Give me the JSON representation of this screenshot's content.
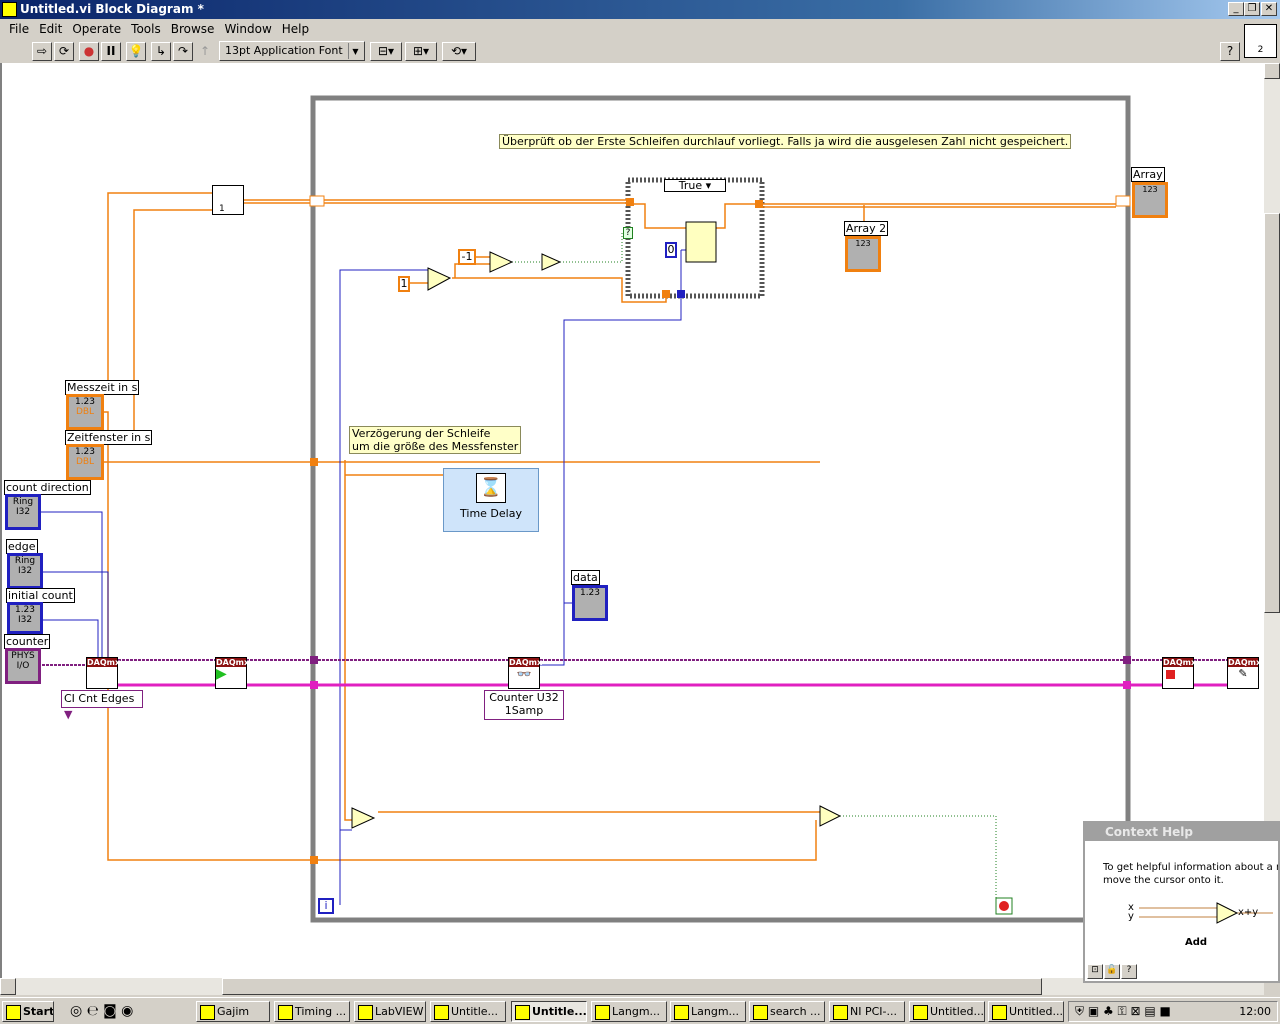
{
  "window": {
    "title": "Untitled.vi Block Diagram *"
  },
  "menu": [
    "File",
    "Edit",
    "Operate",
    "Tools",
    "Browse",
    "Window",
    "Help"
  ],
  "toolbar": {
    "font": "13pt Application Font",
    "instance": "2"
  },
  "diagram": {
    "comment1": "Überprüft ob der Erste Schleifen durchlauf vorliegt. Falls ja wird die ausgelesen Zahl nicht gespeichert.",
    "comment2_line1": "Verzögerung der Schleife",
    "comment2_line2": "um die größe des Messfenster",
    "controls": [
      {
        "label": "Messzeit in s",
        "value": "1.23",
        "type": "DBL"
      },
      {
        "label": "Zeitfenster in s",
        "value": "1.23",
        "type": "DBL"
      },
      {
        "label": "count direction",
        "value": "Ring",
        "type": "I32"
      },
      {
        "label": "edge",
        "value": "Ring",
        "type": "I32"
      },
      {
        "label": "initial count",
        "value": "1.23",
        "type": "I32"
      },
      {
        "label": "counter",
        "value": "PHYS",
        "type": "I/O"
      }
    ],
    "indicators": {
      "array": "Array",
      "array2": "Array 2",
      "data": "data",
      "data_value": "1.23",
      "idx": "123"
    },
    "case_selector": "True",
    "constants": {
      "minus_one": "-1",
      "one": "1",
      "zero": "0",
      "build_index": "1"
    },
    "time_delay": "Time Delay",
    "ci_type": "CI Cnt Edges",
    "read_type_line1": "Counter U32",
    "read_type_line2": "1Samp",
    "daqmx": "DAQmx",
    "iteration": "i",
    "question": "?"
  },
  "context_help": {
    "title": "Context Help",
    "text_line1": "To get helpful information about a node,",
    "text_line2": "move the cursor onto it.",
    "x": "x",
    "y": "y",
    "out": "x+y",
    "name": "Add"
  },
  "taskbar": {
    "start": "Start",
    "tasks": [
      "Gajim",
      "Timing ...",
      "LabVIEW",
      "Untitle...",
      "Untitle...",
      "Langm...",
      "Langm...",
      "search ...",
      "NI PCI-...",
      "Untitled...",
      "Untitled..."
    ],
    "active": 4,
    "clock": "12:00"
  },
  "colors": {
    "orange_wire": "#f08010",
    "blue_wire": "#2020c0",
    "purple_wire": "#802080",
    "pink_wire": "#e020c0"
  }
}
